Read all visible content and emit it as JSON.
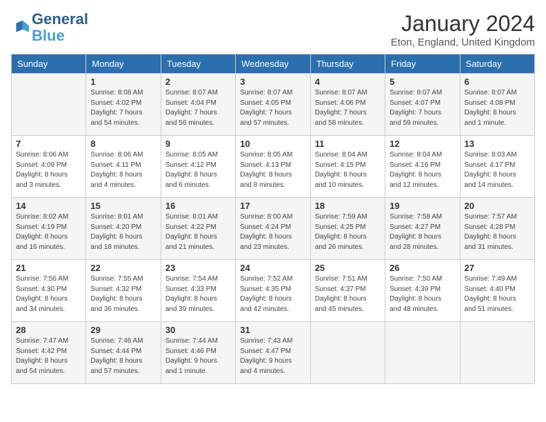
{
  "logo": {
    "line1": "General",
    "line2": "Blue"
  },
  "title": "January 2024",
  "subtitle": "Eton, England, United Kingdom",
  "days_of_week": [
    "Sunday",
    "Monday",
    "Tuesday",
    "Wednesday",
    "Thursday",
    "Friday",
    "Saturday"
  ],
  "weeks": [
    [
      {
        "day": "",
        "info": ""
      },
      {
        "day": "1",
        "info": "Sunrise: 8:08 AM\nSunset: 4:02 PM\nDaylight: 7 hours\nand 54 minutes."
      },
      {
        "day": "2",
        "info": "Sunrise: 8:07 AM\nSunset: 4:04 PM\nDaylight: 7 hours\nand 56 minutes."
      },
      {
        "day": "3",
        "info": "Sunrise: 8:07 AM\nSunset: 4:05 PM\nDaylight: 7 hours\nand 57 minutes."
      },
      {
        "day": "4",
        "info": "Sunrise: 8:07 AM\nSunset: 4:06 PM\nDaylight: 7 hours\nand 58 minutes."
      },
      {
        "day": "5",
        "info": "Sunrise: 8:07 AM\nSunset: 4:07 PM\nDaylight: 7 hours\nand 59 minutes."
      },
      {
        "day": "6",
        "info": "Sunrise: 8:07 AM\nSunset: 4:08 PM\nDaylight: 8 hours\nand 1 minute."
      }
    ],
    [
      {
        "day": "7",
        "info": "Sunrise: 8:06 AM\nSunset: 4:09 PM\nDaylight: 8 hours\nand 3 minutes."
      },
      {
        "day": "8",
        "info": "Sunrise: 8:06 AM\nSunset: 4:11 PM\nDaylight: 8 hours\nand 4 minutes."
      },
      {
        "day": "9",
        "info": "Sunrise: 8:05 AM\nSunset: 4:12 PM\nDaylight: 8 hours\nand 6 minutes."
      },
      {
        "day": "10",
        "info": "Sunrise: 8:05 AM\nSunset: 4:13 PM\nDaylight: 8 hours\nand 8 minutes."
      },
      {
        "day": "11",
        "info": "Sunrise: 8:04 AM\nSunset: 4:15 PM\nDaylight: 8 hours\nand 10 minutes."
      },
      {
        "day": "12",
        "info": "Sunrise: 8:04 AM\nSunset: 4:16 PM\nDaylight: 8 hours\nand 12 minutes."
      },
      {
        "day": "13",
        "info": "Sunrise: 8:03 AM\nSunset: 4:17 PM\nDaylight: 8 hours\nand 14 minutes."
      }
    ],
    [
      {
        "day": "14",
        "info": "Sunrise: 8:02 AM\nSunset: 4:19 PM\nDaylight: 8 hours\nand 16 minutes."
      },
      {
        "day": "15",
        "info": "Sunrise: 8:01 AM\nSunset: 4:20 PM\nDaylight: 8 hours\nand 18 minutes."
      },
      {
        "day": "16",
        "info": "Sunrise: 8:01 AM\nSunset: 4:22 PM\nDaylight: 8 hours\nand 21 minutes."
      },
      {
        "day": "17",
        "info": "Sunrise: 8:00 AM\nSunset: 4:24 PM\nDaylight: 8 hours\nand 23 minutes."
      },
      {
        "day": "18",
        "info": "Sunrise: 7:59 AM\nSunset: 4:25 PM\nDaylight: 8 hours\nand 26 minutes."
      },
      {
        "day": "19",
        "info": "Sunrise: 7:58 AM\nSunset: 4:27 PM\nDaylight: 8 hours\nand 28 minutes."
      },
      {
        "day": "20",
        "info": "Sunrise: 7:57 AM\nSunset: 4:28 PM\nDaylight: 8 hours\nand 31 minutes."
      }
    ],
    [
      {
        "day": "21",
        "info": "Sunrise: 7:56 AM\nSunset: 4:30 PM\nDaylight: 8 hours\nand 34 minutes."
      },
      {
        "day": "22",
        "info": "Sunrise: 7:55 AM\nSunset: 4:32 PM\nDaylight: 8 hours\nand 36 minutes."
      },
      {
        "day": "23",
        "info": "Sunrise: 7:54 AM\nSunset: 4:33 PM\nDaylight: 8 hours\nand 39 minutes."
      },
      {
        "day": "24",
        "info": "Sunrise: 7:52 AM\nSunset: 4:35 PM\nDaylight: 8 hours\nand 42 minutes."
      },
      {
        "day": "25",
        "info": "Sunrise: 7:51 AM\nSunset: 4:37 PM\nDaylight: 8 hours\nand 45 minutes."
      },
      {
        "day": "26",
        "info": "Sunrise: 7:50 AM\nSunset: 4:39 PM\nDaylight: 8 hours\nand 48 minutes."
      },
      {
        "day": "27",
        "info": "Sunrise: 7:49 AM\nSunset: 4:40 PM\nDaylight: 8 hours\nand 51 minutes."
      }
    ],
    [
      {
        "day": "28",
        "info": "Sunrise: 7:47 AM\nSunset: 4:42 PM\nDaylight: 8 hours\nand 54 minutes."
      },
      {
        "day": "29",
        "info": "Sunrise: 7:46 AM\nSunset: 4:44 PM\nDaylight: 8 hours\nand 57 minutes."
      },
      {
        "day": "30",
        "info": "Sunrise: 7:44 AM\nSunset: 4:46 PM\nDaylight: 9 hours\nand 1 minute."
      },
      {
        "day": "31",
        "info": "Sunrise: 7:43 AM\nSunset: 4:47 PM\nDaylight: 9 hours\nand 4 minutes."
      },
      {
        "day": "",
        "info": ""
      },
      {
        "day": "",
        "info": ""
      },
      {
        "day": "",
        "info": ""
      }
    ]
  ]
}
